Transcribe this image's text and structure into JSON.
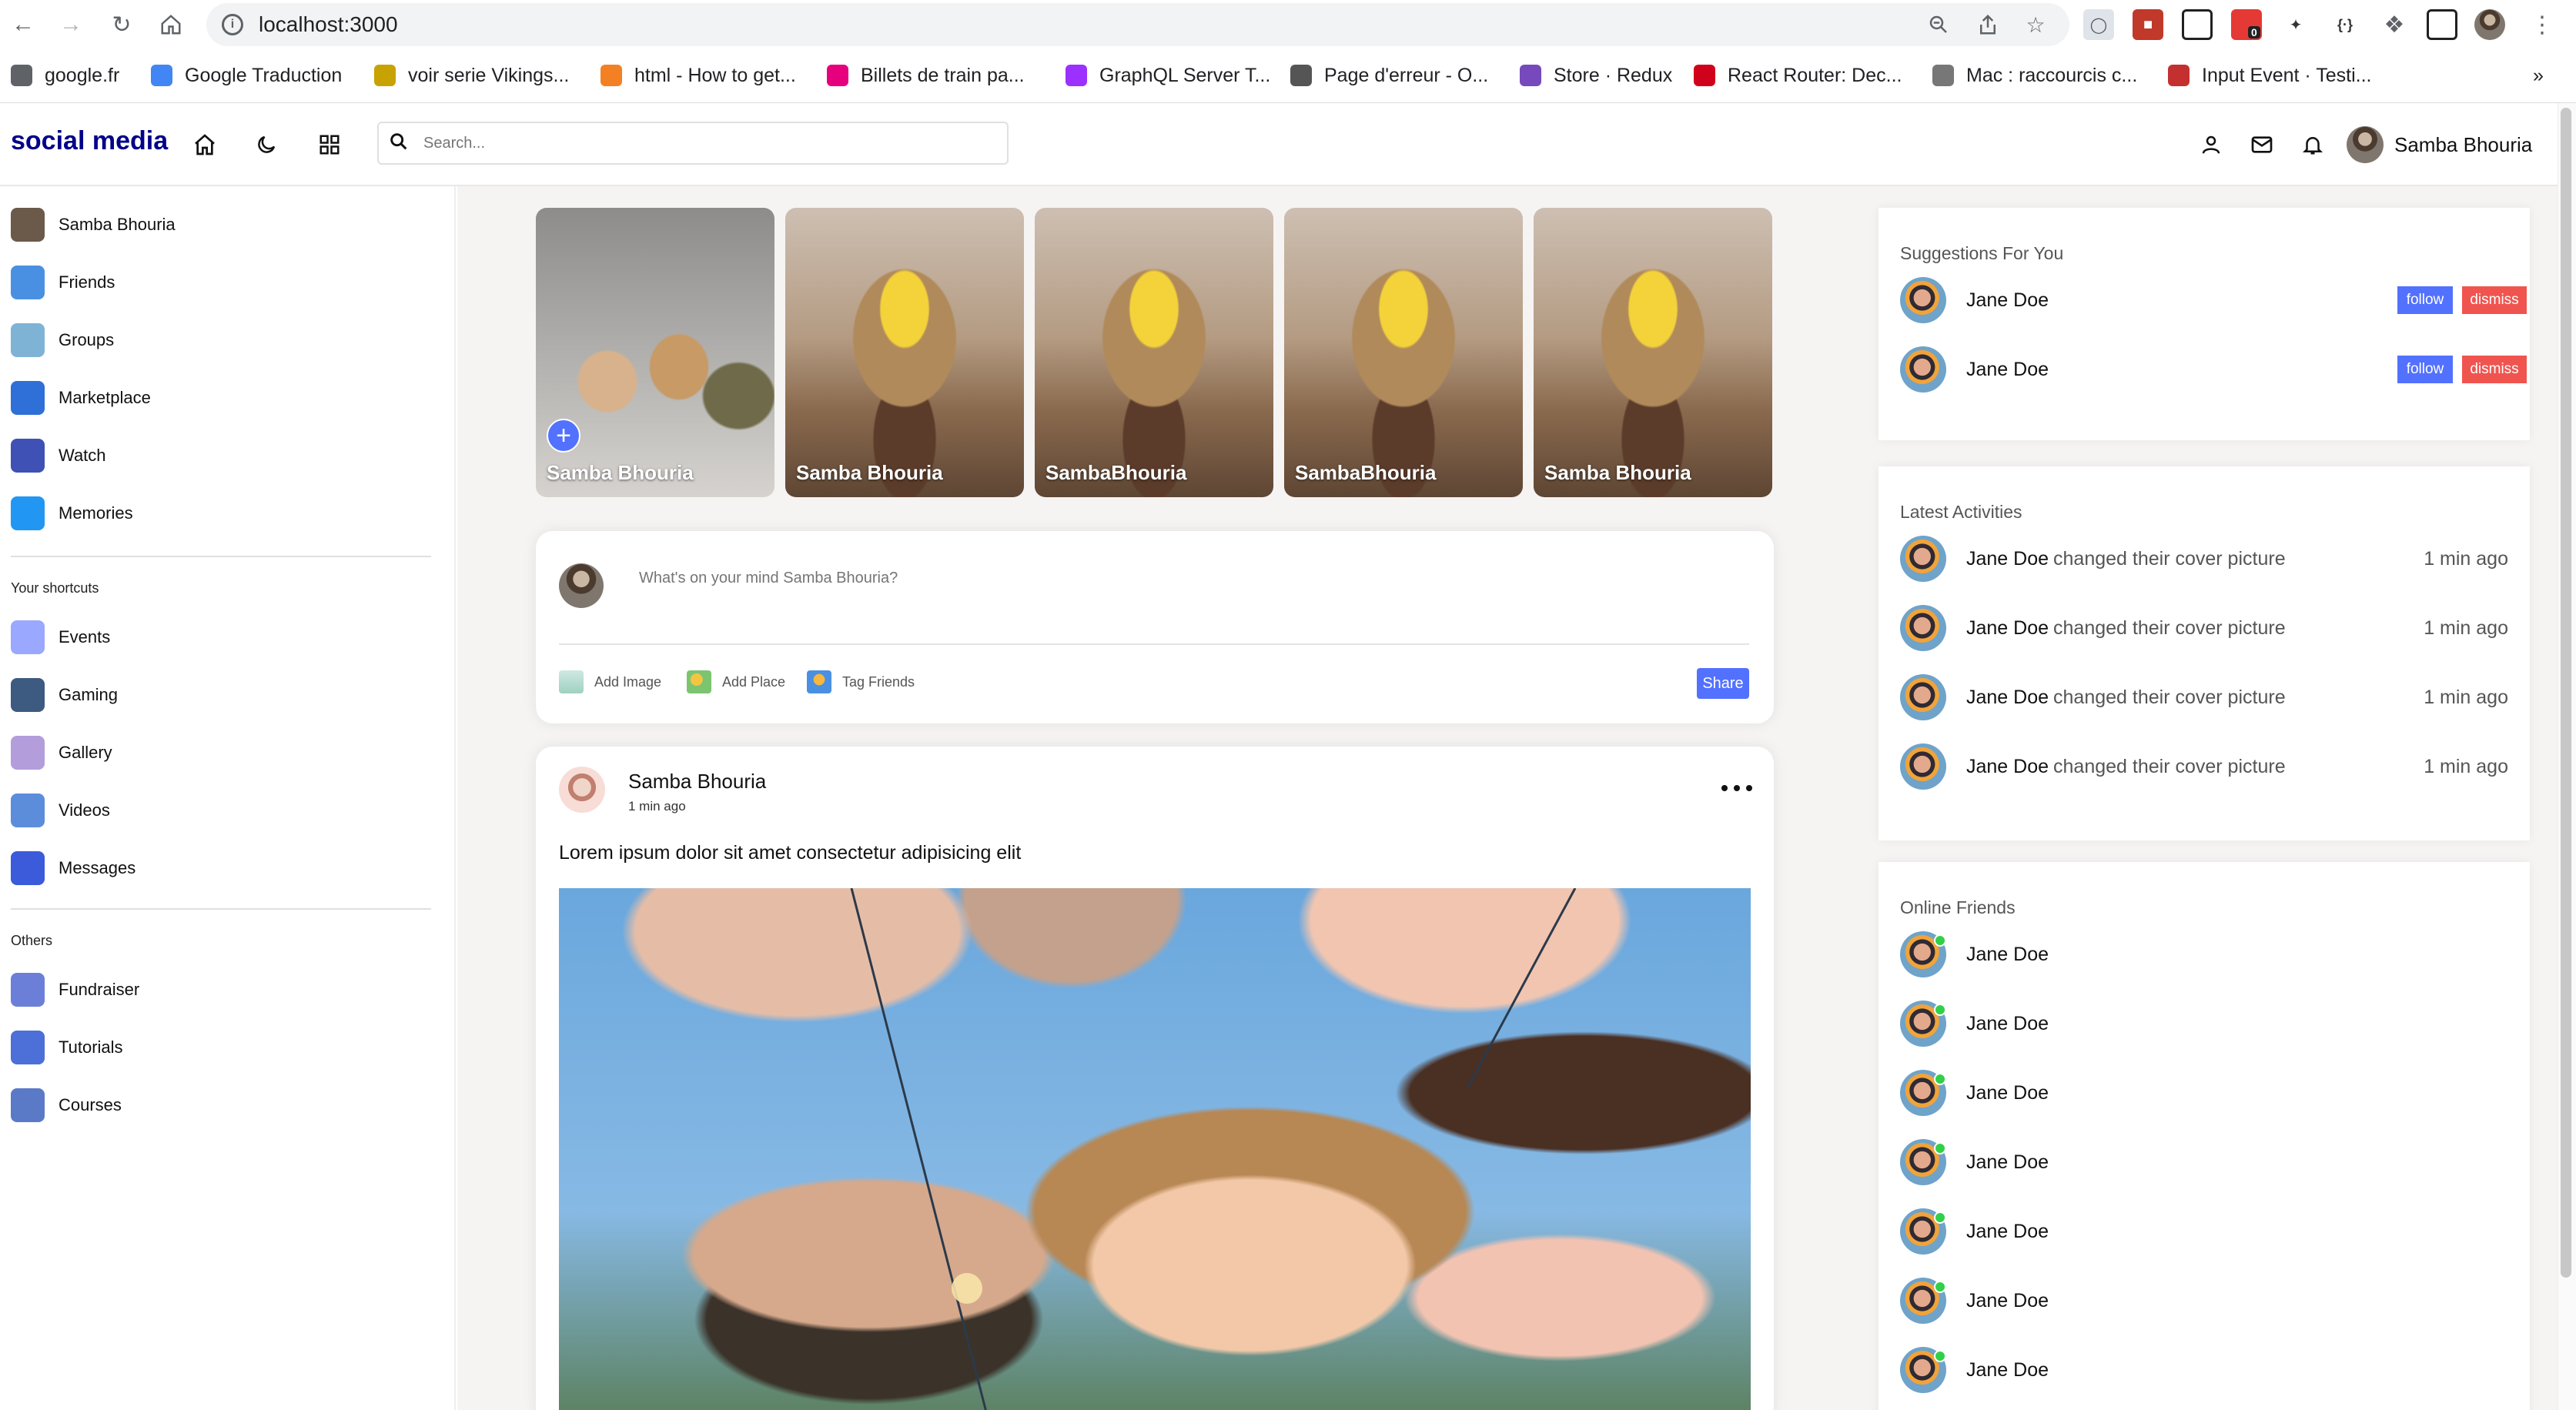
{
  "browser": {
    "url": "localhost:3000",
    "extension_badge": "0",
    "bookmarks": [
      {
        "label": "google.fr",
        "color": "#5f6368"
      },
      {
        "label": "Google Traduction",
        "color": "#4285f4"
      },
      {
        "label": "voir serie Vikings...",
        "color": "#c8a200"
      },
      {
        "label": "html - How to get...",
        "color": "#f48024"
      },
      {
        "label": "Billets de train pa...",
        "color": "#e6007e"
      },
      {
        "label": "GraphQL Server T...",
        "color": "#9b30ff"
      },
      {
        "label": "Page d'erreur - O...",
        "color": "#555555"
      },
      {
        "label": "Store · Redux",
        "color": "#764abc"
      },
      {
        "label": "React Router: Dec...",
        "color": "#d0021b"
      },
      {
        "label": "Mac : raccourcis c...",
        "color": "#777777"
      },
      {
        "label": "Input Event · Testi...",
        "color": "#c3302f"
      }
    ]
  },
  "navbar": {
    "logo": "social media",
    "search_placeholder": "Search...",
    "user_name": "Samba Bhouria"
  },
  "sidebar": {
    "main_items": [
      {
        "label": "Samba Bhouria",
        "icon": "user-avatar-icon",
        "color": "#6b5a4a"
      },
      {
        "label": "Friends",
        "icon": "friends-icon",
        "color": "#4a90e2"
      },
      {
        "label": "Groups",
        "icon": "groups-icon",
        "color": "#7fb3d5"
      },
      {
        "label": "Marketplace",
        "icon": "marketplace-icon",
        "color": "#2f6fd8"
      },
      {
        "label": "Watch",
        "icon": "watch-icon",
        "color": "#3f51b5"
      },
      {
        "label": "Memories",
        "icon": "memories-icon",
        "color": "#2196f3"
      }
    ],
    "shortcuts_title": "Your shortcuts",
    "shortcut_items": [
      {
        "label": "Events",
        "icon": "events-icon",
        "color": "#9aa8ff"
      },
      {
        "label": "Gaming",
        "icon": "gaming-icon",
        "color": "#3d5a80"
      },
      {
        "label": "Gallery",
        "icon": "gallery-icon",
        "color": "#b39ddb"
      },
      {
        "label": "Videos",
        "icon": "videos-icon",
        "color": "#5c8ddb"
      },
      {
        "label": "Messages",
        "icon": "messages-icon",
        "color": "#3b5bdb"
      }
    ],
    "others_title": "Others",
    "other_items": [
      {
        "label": "Fundraiser",
        "icon": "fundraiser-icon",
        "color": "#6c7fd8"
      },
      {
        "label": "Tutorials",
        "icon": "tutorials-icon",
        "color": "#4c6fd8"
      },
      {
        "label": "Courses",
        "icon": "courses-icon",
        "color": "#5a7ac8"
      }
    ]
  },
  "stories": [
    {
      "name": "Samba Bhouria",
      "image": "group-of-friends"
    },
    {
      "name": "Samba Bhouria",
      "image": "flower-bouquet"
    },
    {
      "name": "SambaBhouria",
      "image": "flower-bouquet"
    },
    {
      "name": "SambaBhouria",
      "image": "flower-bouquet"
    },
    {
      "name": "Samba Bhouria",
      "image": "flower-bouquet"
    }
  ],
  "share": {
    "placeholder": "What's on your mind Samba Bhouria?",
    "add_image": "Add Image",
    "add_place": "Add Place",
    "tag_friends": "Tag Friends",
    "share_button": "Share"
  },
  "post": {
    "author": "Samba Bhouria",
    "time": "1 min ago",
    "text": "Lorem ipsum dolor sit amet consectetur adipisicing elit"
  },
  "suggestions": {
    "title": "Suggestions For You",
    "follow_label": "follow",
    "dismiss_label": "dismiss",
    "users": [
      "Jane Doe",
      "Jane Doe"
    ]
  },
  "activities": {
    "title": "Latest Activities",
    "items": [
      {
        "name": "Jane Doe",
        "action": "changed their cover picture",
        "time": "1 min ago"
      },
      {
        "name": "Jane Doe",
        "action": "changed their cover picture",
        "time": "1 min ago"
      },
      {
        "name": "Jane Doe",
        "action": "changed their cover picture",
        "time": "1 min ago"
      },
      {
        "name": "Jane Doe",
        "action": "changed their cover picture",
        "time": "1 min ago"
      }
    ]
  },
  "online": {
    "title": "Online Friends",
    "friends": [
      "Jane Doe",
      "Jane Doe",
      "Jane Doe",
      "Jane Doe",
      "Jane Doe",
      "Jane Doe",
      "Jane Doe"
    ]
  },
  "colors": {
    "accent": "#5271ff",
    "logo": "#00008b",
    "dismiss": "#f0544f",
    "online": "#31d048"
  }
}
